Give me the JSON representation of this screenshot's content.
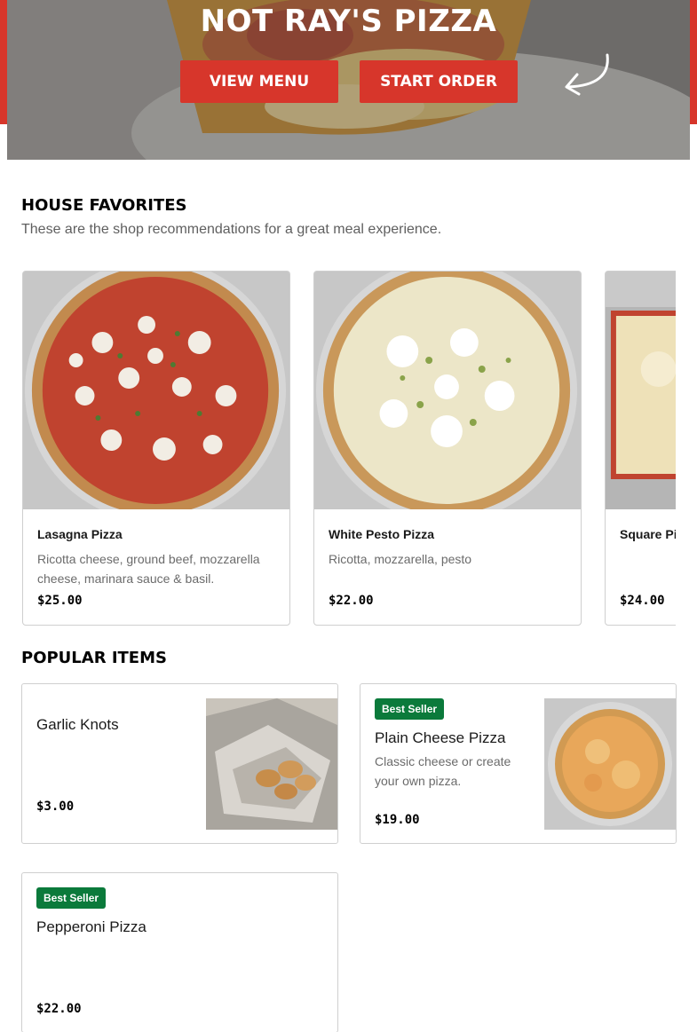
{
  "hero": {
    "title": "NOT RAY'S PIZZA",
    "view_menu_label": "VIEW MENU",
    "start_order_label": "START ORDER",
    "accent_color": "#d7362b"
  },
  "house_favorites": {
    "title": "HOUSE FAVORITES",
    "subtitle": "These are the shop recommendations for a great meal experience.",
    "items": [
      {
        "name": "Lasagna Pizza",
        "description": "Ricotta cheese, ground beef, mozzarella cheese, marinara sauce & basil.",
        "price": "$25.00"
      },
      {
        "name": "White Pesto Pizza",
        "description": "Ricotta, mozzarella, pesto",
        "price": "$22.00"
      },
      {
        "name": "Square Pizza",
        "description": "",
        "price": "$24.00"
      }
    ]
  },
  "popular_items": {
    "title": "POPULAR ITEMS",
    "badge_color": "#0b7a3b",
    "items": [
      {
        "name": "Garlic Knots",
        "badge": "",
        "description": "",
        "price": "$3.00"
      },
      {
        "name": "Plain Cheese Pizza",
        "badge": "Best Seller",
        "description": "Classic cheese or create your own pizza.",
        "price": "$19.00"
      },
      {
        "name": "Pepperoni Pizza",
        "badge": "Best Seller",
        "description": "",
        "price": "$22.00"
      }
    ]
  }
}
